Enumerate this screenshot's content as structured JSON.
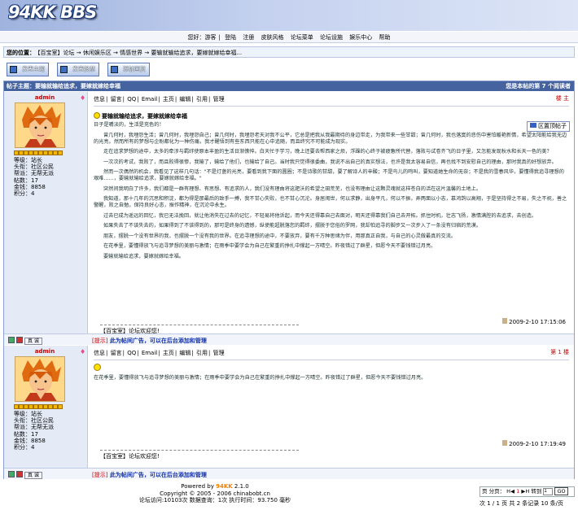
{
  "header": {
    "logo": "94KK BBS"
  },
  "nav": [
    "您好：游客",
    "登陆",
    "注册",
    "皮肤风格",
    "论坛菜单",
    "论坛设施",
    "娱乐中心",
    "帮助"
  ],
  "crumb": {
    "label": "您的位置：",
    "path": "【百宝室】论坛 → 休闲娱乐区 → 情感世界 → 要输就输给追求，要嫁就嫁给幸福..."
  },
  "buttons": [
    "发表主题",
    "发表投票",
    "添加回复"
  ],
  "thread": {
    "title": "帖子主题：要输就输给追求，要嫁就嫁给幸福",
    "views": "您是本帖的第 7 个阅读者"
  },
  "toolbar": [
    "信息",
    "|",
    "留言",
    "|",
    "QQ",
    "|",
    "Email",
    "|",
    "主页",
    "|",
    "编辑",
    "|",
    "引用",
    "|",
    "管理"
  ],
  "user": {
    "name": "admin",
    "stats": [
      "等级：站长",
      "头衔：社区公民",
      "帮派：无帮无派",
      "帖数：17",
      "金钱：8858",
      "积分：4"
    ]
  },
  "post1": {
    "floor": "楼 主",
    "title": "要输就输给追求，要嫁就嫁给幸福",
    "quick": "区置顶帖子",
    "paras": [
      "日子是嚼淡的，生活是充色的！",
      "曾几何时，我埋怨生活；曾几何时，我埋怨自己；曾几何时，我埋怨老天对我不公平，它总是把我从我最期待的身边带走，为我带来一些甘甜；曾几何时，我也落寞的悲伤中害怕暖艳新情，希望太阳能给我无边的光亮。然而所有的梦想与企盼都化为一种伤痛，我才醒悟到有些东西只能在心中追随，而且终究不可能成为现实。",
      "走在追求梦想的途中，太多的牵涉与羁绊使原本丰盈的生活日渐憔悴。白天忙于学习，晚上还要去帮西家之烦，浮躁的心终于被疲惫所代替，落败与试卷齐飞的日子里，又怎能发现秋水和长天一色的美？",
      "一次次的考试，我败了，而且败得很惨，我输了，输给了他们，也输给了自己。当时我只觉得很委曲，我说不出自己的真实想法，也许是我太容易自信，再也找不到安慰自己的理由，那时我真的好想放弃。",
      "然而一次偶然的机会，我看见了这样几句话：\"不是灯盏的光亮，要看到我下面的圆圈；不是诗歌的甘甜，要了解诗人的辛酸；不是鸟儿的鸣叫，要知道她生命的无奈；不是我的雪春风华，要懂得我追寻理想的艰难……，要输就输给追求，要嫁就嫁给幸福。\"",
      "突然间我明白了许多，我们都是一群有理想、有思想、有追求的人，我们没有理由将这肥沃的希望之田荒芜，也没有理由让这颗灵魂就这样苍白的活在这片温馨的土地上。",
      "我知道，那十几年的沉思和积淀，都为得是那最后的致手一搏，我不甘心失败，也不甘心沉沦。身居闹世，何以求静，出身平凡，何以不振，弄两面以小志，慕鸿鹄以高翔，于是坚持得之不易，失之不祝，善之警醒，败之自勉，保持良好心态，振作精神，在沉沦中永生。",
      "过去已成为遥远的回忆，我已无法挽回，就让他消失在过去的记忆，不轻易将他诉起，而今天还得靠自己去面对，明天还得靠我们自己去开拓。抓住时机，壮志飞扬，激情满腔的去追求，去创造。",
      "如果失去了不该失去的，如果得到了不该得到的，那可是终身的遗憾，纵使能超脱落您的羁绊，摆脱于您俗的罗网，我却怕追寻的脚步又一次步入了一条没有归宿的荒漠。",
      "朋友，摆脱一个没有世界的我，也摆脱一个没有我的世界。在追寻理想的途中，不要放弃，要有千万种思绪为伴，用那真正自我，与自己的心灵做最真的交流。",
      "在花季里，要懂得放飞与追寻梦想的美丽与激情；在雨季中要学会为自己在繁重的挣扎中撑起一方晴空。昨夜错过了群星，但愿今天不要钱错过月亮。",
      "要输就输给追求，要嫁就嫁给幸福。"
    ],
    "date": "2009-2-10 17:15:06",
    "sig": "【百宝室】论坛欢迎您!"
  },
  "post2": {
    "floor": "第 1 楼",
    "text": "在花季里，要懂得放飞与追寻梦想的美丽与激情；在雨季中要学会为自己在繁重的挣扎中撑起一方晴空。昨夜错过了群星，但愿今天不要钱错过月亮。",
    "date": "2009-2-10 17:19:49",
    "sig": "【百宝室】论坛欢迎您!"
  },
  "postfoot": {
    "tag": "真 诚",
    "tip": "[提示]",
    "ad": "此为帖间广告，可以在后台添加和管理"
  },
  "footer": {
    "line1_a": "Powered by ",
    "line1_b": "94KK",
    "line1_c": " 2.1.0",
    "line2": "Copyright © 2005 - 2006 chinabobt.cn",
    "line3": "论坛访问:10103次 数据查询：1次 执行时间：93.750 毫秒"
  },
  "pager": {
    "label": "页 分页：",
    "prev": "H◀",
    "cur": "1",
    "next": "▶H",
    "jump": "转到",
    "page": "1",
    "go": "GO",
    "info": "次 1 / 1 页 共 2 条记录 10 条/页"
  }
}
